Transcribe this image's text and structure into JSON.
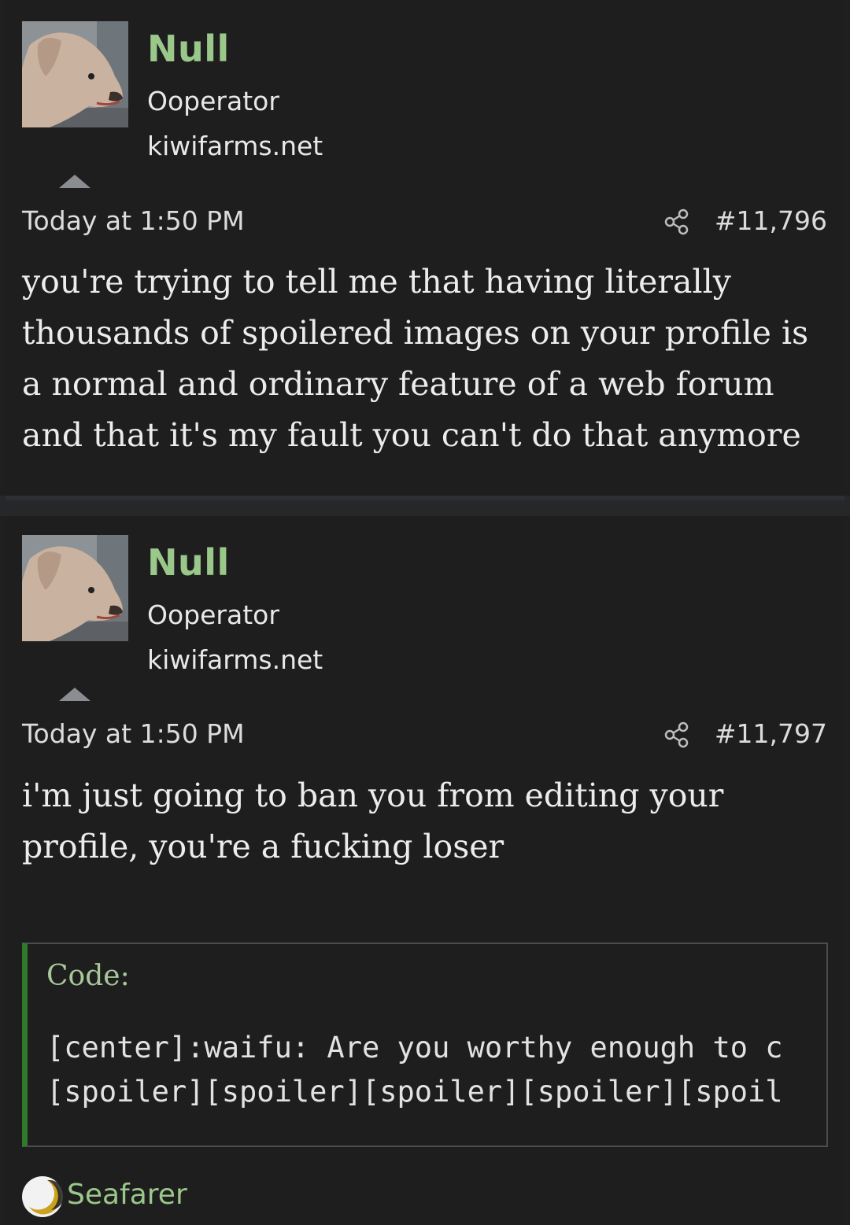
{
  "posts": [
    {
      "username": "Null",
      "user_title": "Ooperator",
      "user_banner": "kiwifarms.net",
      "timestamp": "Today at 1:50 PM",
      "post_number": "#11,796",
      "body_lines": [
        "you're trying to tell me that having literally",
        "thousands of spoilered images on your profile is",
        "a normal and ordinary feature of a web forum",
        "and that it's my fault you can't do that anymore"
      ]
    },
    {
      "username": "Null",
      "user_title": "Ooperator",
      "user_banner": "kiwifarms.net",
      "timestamp": "Today at 1:50 PM",
      "post_number": "#11,797",
      "body_lines": [
        "i'm just going to ban you from editing your",
        "profile, you're a fucking loser"
      ],
      "code_block": {
        "title": "Code:",
        "lines": [
          "[center]:waifu: Are you worthy enough to c",
          "[spoiler][spoiler][spoiler][spoiler][spoil"
        ]
      },
      "reaction": {
        "icon": "moon-icon",
        "name": "Seafarer"
      }
    }
  ],
  "colors": {
    "background": "#1f1f1f",
    "username": "#9ac78a",
    "code_border_accent": "#2f7a2a"
  }
}
